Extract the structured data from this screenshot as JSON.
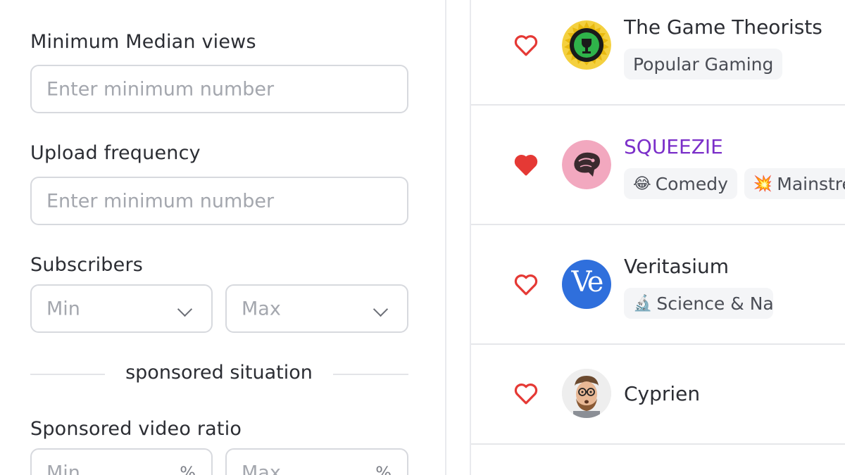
{
  "filters": {
    "median_views": {
      "label": "Minimum Median views",
      "placeholder": "Enter minimum number"
    },
    "upload_frequency": {
      "label": "Upload frequency",
      "placeholder": "Enter minimum number"
    },
    "subscribers": {
      "label": "Subscribers",
      "min_placeholder": "Min",
      "max_placeholder": "Max"
    },
    "section_divider": "sponsored situation",
    "sponsored_ratio": {
      "label": "Sponsored video ratio",
      "min_placeholder": "Min",
      "max_placeholder": "Max",
      "unit": "%"
    }
  },
  "channels": [
    {
      "name": "The Game Theorists",
      "favorited": false,
      "highlighted": false,
      "avatar_icon": "game-theory-logo",
      "tags": [
        {
          "label": "Popular Gaming",
          "emoji": ""
        }
      ]
    },
    {
      "name": "SQUEEZIE",
      "favorited": true,
      "highlighted": true,
      "avatar_icon": "squeezie-avatar",
      "tags": [
        {
          "label": "Comedy",
          "emoji": "😂"
        },
        {
          "label": "Mainstre",
          "emoji": "💥"
        }
      ]
    },
    {
      "name": "Veritasium",
      "favorited": false,
      "highlighted": false,
      "avatar_icon": "veritasium-logo",
      "avatar_text": "Ve",
      "tags": [
        {
          "label": "Science & Nat",
          "emoji": "🔬"
        }
      ]
    },
    {
      "name": "Cyprien",
      "favorited": false,
      "highlighted": false,
      "avatar_icon": "cyprien-avatar",
      "tags": []
    }
  ],
  "colors": {
    "heart": "#e53935",
    "highlight_name": "#7b2fc9",
    "veritasium_blue": "#2f6fdc",
    "squeezie_pink": "#f2a8bf"
  }
}
